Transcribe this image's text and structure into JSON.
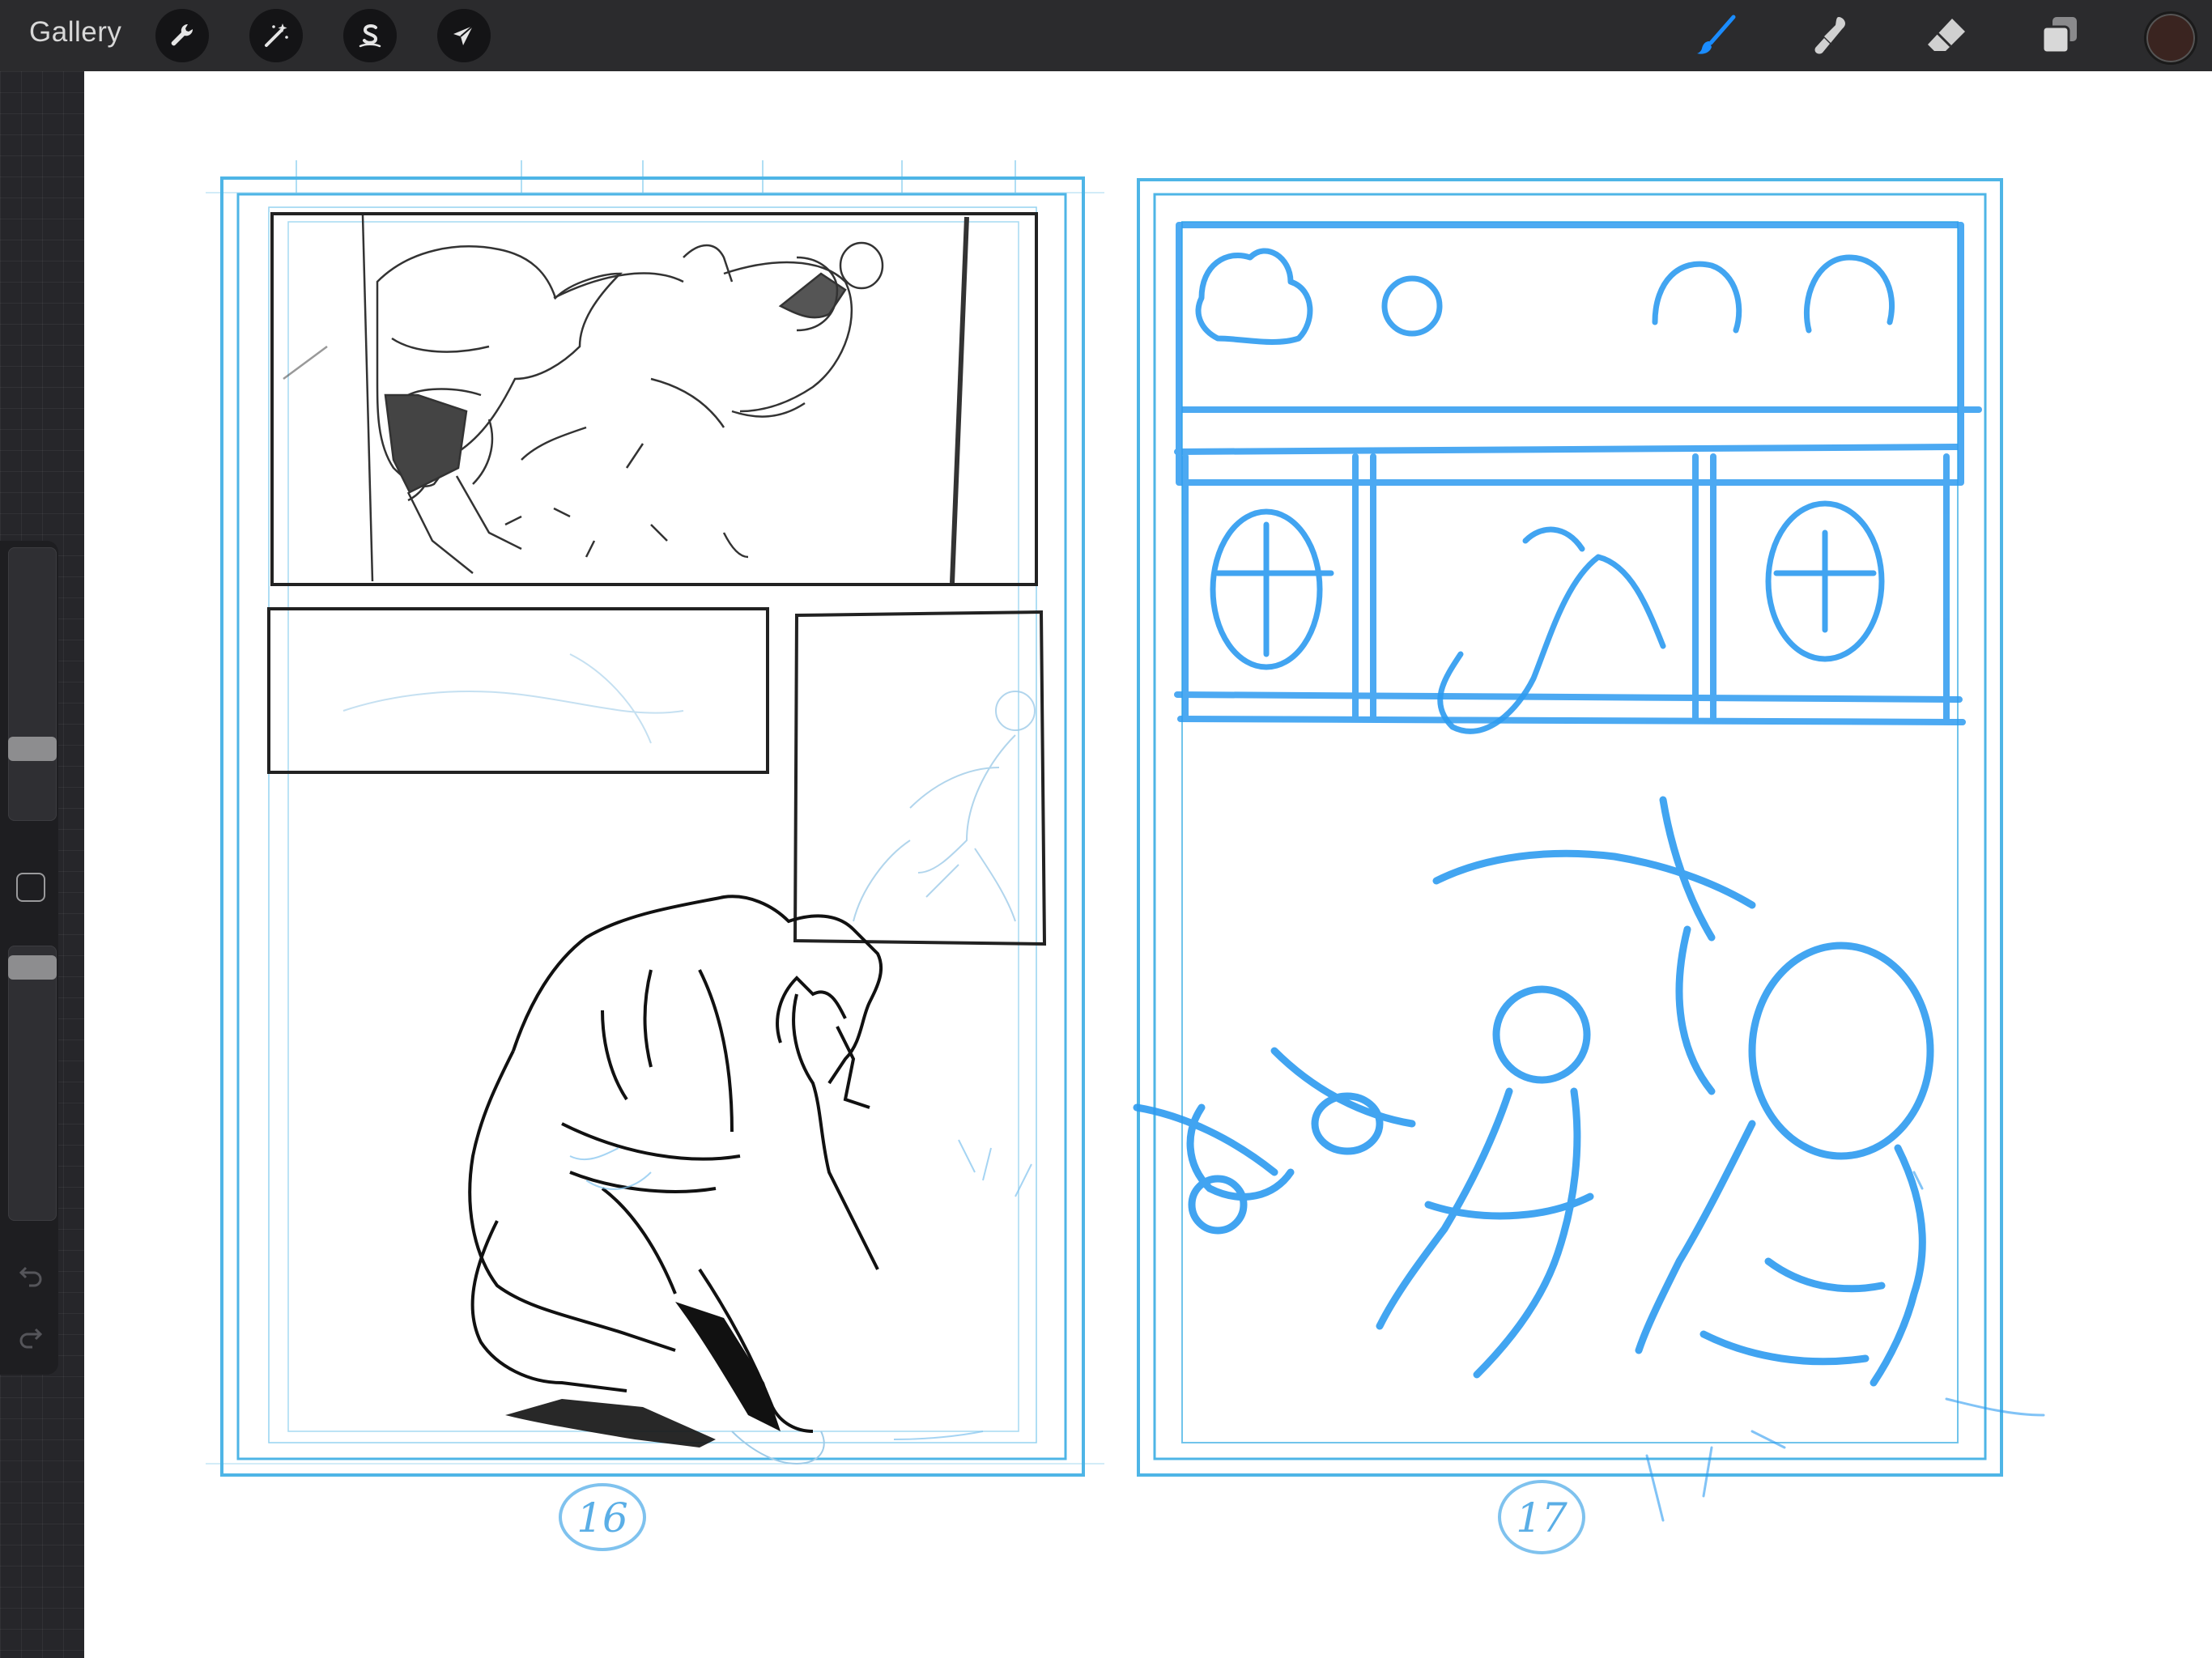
{
  "app": {
    "gallery_label": "Gallery"
  },
  "toolbar_left": [
    {
      "name": "actions",
      "icon": "wrench-icon"
    },
    {
      "name": "adjustments",
      "icon": "magic-wand-icon"
    },
    {
      "name": "selection",
      "icon": "selection-s-icon"
    },
    {
      "name": "transform",
      "icon": "arrow-cursor-icon"
    }
  ],
  "toolbar_right": [
    {
      "name": "brush",
      "icon": "brush-icon",
      "active": true
    },
    {
      "name": "smudge",
      "icon": "smudge-icon",
      "active": false
    },
    {
      "name": "eraser",
      "icon": "eraser-icon",
      "active": false
    },
    {
      "name": "layers",
      "icon": "layers-icon",
      "active": false
    }
  ],
  "colors": {
    "toolbar_bg": "#2b2b2d",
    "active_tool": "#1a8cff",
    "current_color": "#3a2420",
    "sketch_blue": "#2d9bf0",
    "guide_blue": "#4eb5e6"
  },
  "sidebar": {
    "brush_size_level": 0.24,
    "opacity_level": 0.96
  },
  "pages": [
    {
      "number": "16"
    },
    {
      "number": "17"
    }
  ]
}
